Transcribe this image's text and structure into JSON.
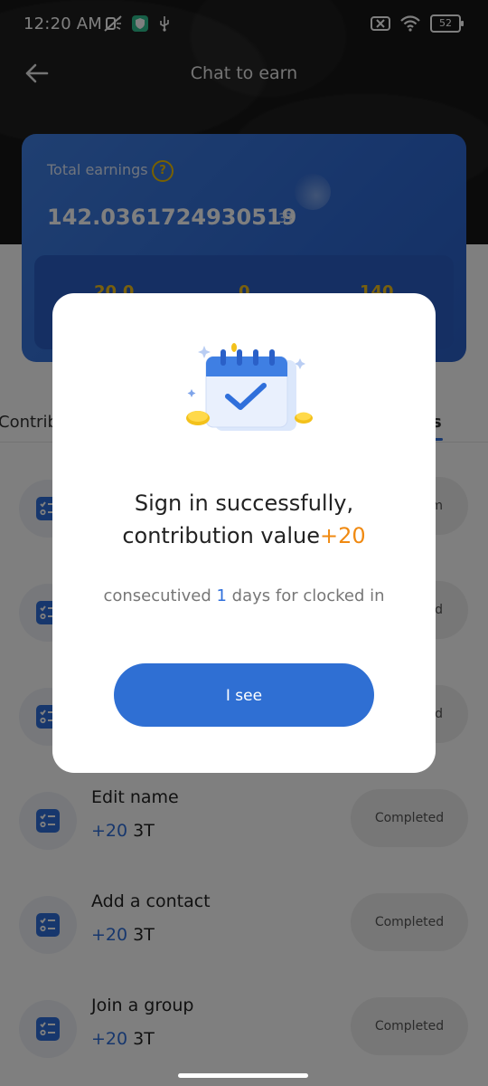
{
  "status_bar": {
    "time": "12:20 AM",
    "battery": "52"
  },
  "nav": {
    "title": "Chat to earn"
  },
  "earnings": {
    "label": "Total earnings",
    "amount": "142.0361724930519",
    "unit": "3T",
    "stats": [
      "20.0",
      "0",
      "140"
    ]
  },
  "tabs": {
    "left_partial": "Contrib",
    "right_partial": "s"
  },
  "tasks": [
    {
      "title": "",
      "reward": "",
      "unit": "",
      "button": "m"
    },
    {
      "title": "",
      "reward": "",
      "unit": "",
      "button": "d"
    },
    {
      "title": "",
      "reward": "",
      "unit": "",
      "button": "d"
    },
    {
      "title": "Edit name",
      "reward": "+20",
      "unit": "3T",
      "button": "Completed"
    },
    {
      "title": "Add a contact",
      "reward": "+20",
      "unit": "3T",
      "button": "Completed"
    },
    {
      "title": "Join a group",
      "reward": "+20",
      "unit": "3T",
      "button": "Completed"
    }
  ],
  "modal": {
    "title_line1": "Sign in successfully,",
    "title_line2": "contribution value",
    "title_bonus": "+20",
    "sub_prefix": "consecutived ",
    "sub_days": "1",
    "sub_suffix": " days for clocked in",
    "button": "I see"
  },
  "colors": {
    "accent": "#2f6fdb",
    "bonus": "#f08a12",
    "card": "#3a7be0"
  }
}
